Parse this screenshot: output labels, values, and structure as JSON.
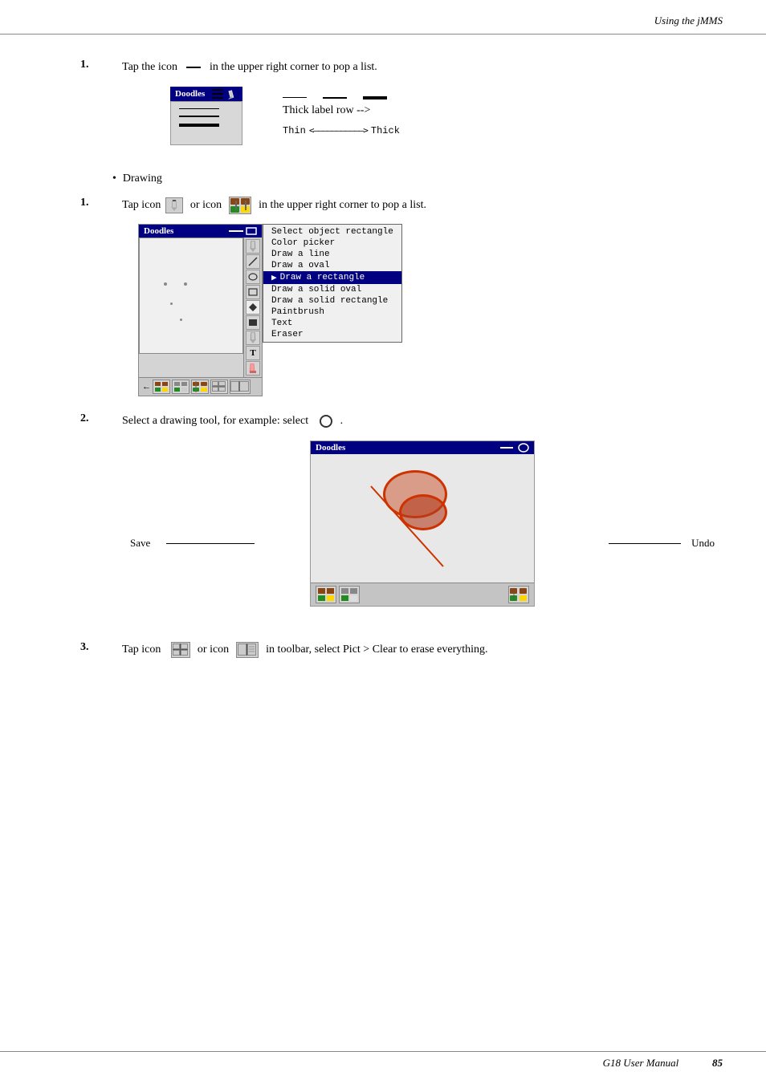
{
  "header": {
    "title": "Using the jMMS"
  },
  "footer": {
    "manual": "G18 User Manual",
    "page": "85"
  },
  "step1": {
    "number": "1.",
    "text_before": "Tap the icon",
    "icon_desc": "—",
    "text_after": "in the upper right corner to pop a list."
  },
  "doodles_title": "Doodles",
  "thin_label": "Thin",
  "thick_label": "Thick",
  "arrow_text": "<–––––––––––>",
  "bullet": "Drawing",
  "step1b": {
    "number": "1.",
    "text1": "Tap icon",
    "icon1": "pencil",
    "text2": "or icon",
    "icon2": "grid",
    "text3": "in the upper right corner to pop a list."
  },
  "menu_items": [
    {
      "label": "Select object rectangle",
      "selected": false
    },
    {
      "label": "Color picker",
      "selected": false
    },
    {
      "label": "Draw a line",
      "selected": false
    },
    {
      "label": "Draw a oval",
      "selected": false
    },
    {
      "label": "Draw a rectangle",
      "selected": true
    },
    {
      "label": "Draw a solid oval",
      "selected": false
    },
    {
      "label": "Draw a solid rectangle",
      "selected": false
    },
    {
      "label": "Paintbrush",
      "selected": false
    },
    {
      "label": "Text",
      "selected": false
    },
    {
      "label": "Eraser",
      "selected": false
    }
  ],
  "step2": {
    "number": "2.",
    "text1": "Select a drawing tool, for example: select",
    "icon": "diamond",
    "text2": "."
  },
  "save_label": "Save",
  "undo_label": "Undo",
  "step3": {
    "number": "3.",
    "text1": "Tap icon",
    "icon1": "grid-small",
    "text2": "or icon",
    "icon2": "grid-lines",
    "text3": "in toolbar, select Pict > Clear to erase everything."
  }
}
